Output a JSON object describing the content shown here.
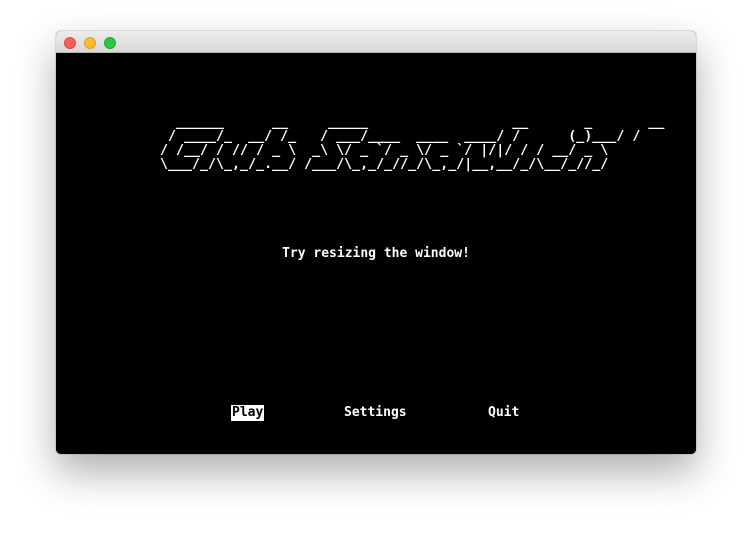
{
  "window": {
    "controls": [
      "close",
      "minimize",
      "maximize"
    ]
  },
  "logo_ascii": "   ______      __     _____                  __       _       __\n  / ____/_  __/ /_   / ___/____  ____  ____/ /      (_)___/ /\n / /__/ / // / _ \\  _\\ \\/ _ `/ _ \\/ _ `/ |/|/ / / __/ _ \\\n \\___/_/\\_,_/_.__/ /___/\\_,_/_//_/\\_,_/|__,__/_/\\__/_//_/",
  "hint_text": "Try resizing the window!",
  "menu": {
    "items": [
      {
        "label": "Play",
        "selected": true
      },
      {
        "label": "Settings",
        "selected": false
      },
      {
        "label": "Quit",
        "selected": false
      }
    ]
  }
}
